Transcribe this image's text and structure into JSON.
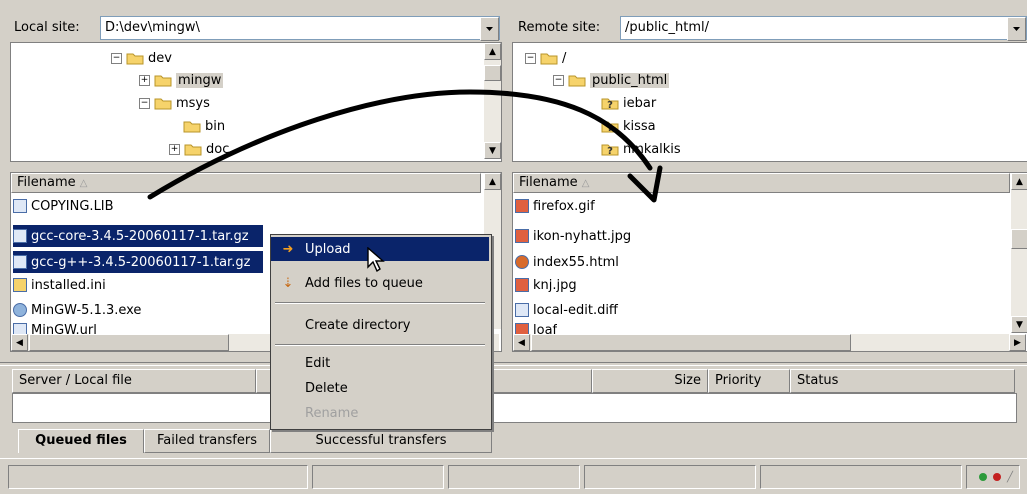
{
  "local": {
    "site_label": "Local site:",
    "path": "D:\\dev\\mingw\\",
    "tree": [
      {
        "label": "dev",
        "expander": "−"
      },
      {
        "label": "mingw",
        "expander": "+"
      },
      {
        "label": "msys",
        "expander": "−"
      },
      {
        "label": "bin",
        "expander": ""
      },
      {
        "label": "doc",
        "expander": "+"
      }
    ],
    "filename_header": "Filename",
    "files": [
      {
        "name": "COPYING.LIB"
      },
      {
        "name": "gcc-core-3.4.5-20060117-1.tar.gz"
      },
      {
        "name": "gcc-g++-3.4.5-20060117-1.tar.gz"
      },
      {
        "name": "installed.ini"
      },
      {
        "name": "MinGW-5.1.3.exe"
      },
      {
        "name": "MinGW.url"
      }
    ]
  },
  "remote": {
    "site_label": "Remote site:",
    "path": "/public_html/",
    "tree": [
      {
        "label": "/",
        "expander": "−"
      },
      {
        "label": "public_html",
        "expander": "−"
      },
      {
        "label": "iebar",
        "expander": ""
      },
      {
        "label": "kissa",
        "expander": ""
      },
      {
        "label": "nmkalkis",
        "expander": ""
      }
    ],
    "filename_header": "Filename",
    "files": [
      {
        "name": "firefox.gif"
      },
      {
        "name": "ikon-nyhatt.jpg"
      },
      {
        "name": "index55.html"
      },
      {
        "name": "knj.jpg"
      },
      {
        "name": "local-edit.diff"
      },
      {
        "name": "loaf"
      }
    ]
  },
  "context_menu": {
    "items": [
      {
        "label": "Upload"
      },
      {
        "label": "Add files to queue"
      },
      {
        "label": "Create directory"
      },
      {
        "label": "Edit"
      },
      {
        "label": "Delete"
      },
      {
        "label": "Rename"
      }
    ]
  },
  "queue": {
    "columns": [
      "Server / Local file",
      "Size",
      "Priority",
      "Status"
    ],
    "tabs": [
      "Queued files",
      "Failed transfers",
      "Successful transfers"
    ]
  },
  "colors": {
    "selection": "#0a246a",
    "folder": "#f6d36b",
    "arrow": "#000000"
  },
  "icons": [
    "folder-icon",
    "help-folder-icon",
    "file-icon",
    "upload-arrow-icon",
    "queue-add-icon",
    "mouse-cursor-icon"
  ]
}
